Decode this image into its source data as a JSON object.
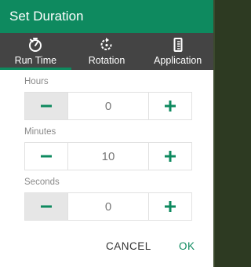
{
  "dialog": {
    "title": "Set Duration"
  },
  "tabs": [
    {
      "label": "Run Time",
      "icon": "timer-icon",
      "active": true
    },
    {
      "label": "Rotation",
      "icon": "rotation-icon",
      "active": false
    },
    {
      "label": "Application",
      "icon": "application-icon",
      "active": false
    }
  ],
  "fields": {
    "hours": {
      "label": "Hours",
      "value": "0"
    },
    "minutes": {
      "label": "Minutes",
      "value": "10"
    },
    "seconds": {
      "label": "Seconds",
      "value": "0"
    }
  },
  "buttons": {
    "minus_glyph": "−",
    "plus_glyph": "+",
    "cancel": "CANCEL",
    "ok": "OK"
  },
  "colors": {
    "accent": "#0e8a5f",
    "tab_bar": "#444444",
    "disabled_bg": "#e6e6e6"
  }
}
